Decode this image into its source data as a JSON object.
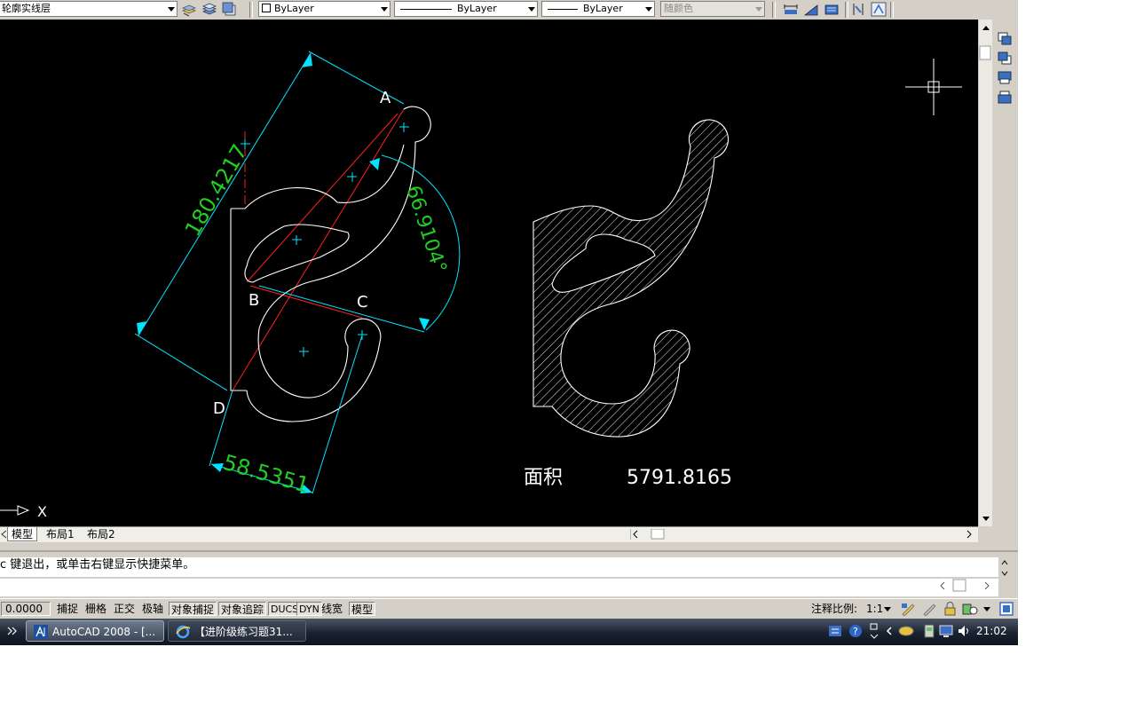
{
  "toolbar": {
    "layer_name": "轮廓实线层",
    "color_value": "ByLayer",
    "linetype_value": "ByLayer",
    "lineweight_value": "ByLayer",
    "plotstyle_value": "随颜色"
  },
  "drawing": {
    "point_labels": {
      "a": "A",
      "b": "B",
      "c": "C",
      "d": "D"
    },
    "dim_length": "180.4217",
    "dim_angle": "66.9104°",
    "dim_width": "58.5351",
    "area_label": "面积",
    "area_value": "5791.8165",
    "ucs_x_label": "X"
  },
  "tabs": [
    {
      "label": "模型",
      "active": true
    },
    {
      "label": "布局1",
      "active": false
    },
    {
      "label": "布局2",
      "active": false
    }
  ],
  "command": {
    "line1": "c 键退出，或单击右键显示快捷菜单。",
    "line2": ""
  },
  "status": {
    "coords": "0.0000",
    "toggles": [
      {
        "label": "捕捉",
        "on": false
      },
      {
        "label": "栅格",
        "on": false
      },
      {
        "label": "正交",
        "on": false
      },
      {
        "label": "极轴",
        "on": false
      },
      {
        "label": "对象捕捉",
        "on": true
      },
      {
        "label": "对象追踪",
        "on": true
      },
      {
        "label": "DUCS",
        "on": true
      },
      {
        "label": "DYN",
        "on": true
      },
      {
        "label": "线宽",
        "on": false
      },
      {
        "label": "模型",
        "on": true
      }
    ],
    "annotation_scale_label": "注释比例:",
    "annotation_scale_value": "1:1"
  },
  "taskbar": {
    "tasks": [
      {
        "label": "AutoCAD 2008 - [..."
      },
      {
        "label": "【进阶级练习题31..."
      }
    ],
    "clock": "21:02"
  },
  "colors": {
    "canvas_bg": "#000000",
    "geometry": "#ffffff",
    "dimension": "#00e5ff",
    "dimension_text": "#22cc22",
    "construction": "#ff2020"
  }
}
